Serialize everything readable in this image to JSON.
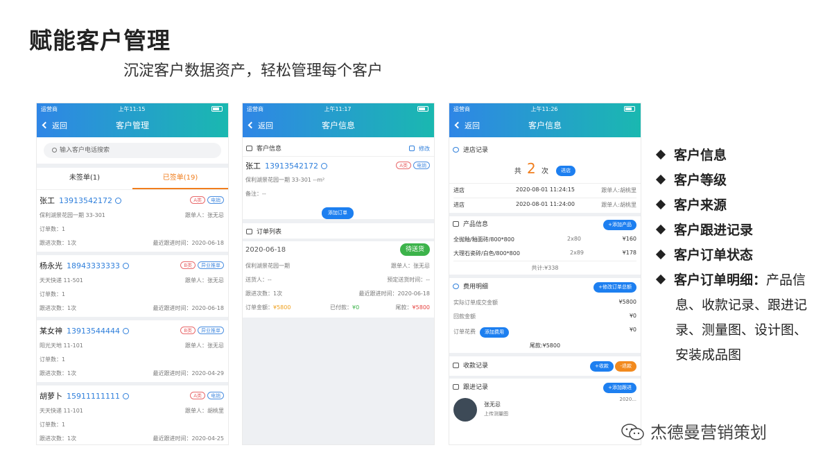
{
  "slide": {
    "title": "赋能客户管理",
    "subtitle": "沉淀客户数据资产，轻松管理每个客户"
  },
  "status_bar": {
    "carrier": "运营商",
    "time1": "上午11:15",
    "time2": "上午11:17",
    "time3": "上午11:26"
  },
  "nav": {
    "back": "返回"
  },
  "screen1": {
    "title": "客户管理",
    "search_placeholder": "输入客户电话搜索",
    "tab_unsigned": "未签单(1)",
    "tab_signed": "已签单(19)",
    "customers": [
      {
        "name": "张工",
        "phone": "13913542172",
        "badges": [
          "A类",
          "电销"
        ],
        "address": "保利湖景花园一期   33-301",
        "follower": "跟单人：张无忌",
        "orders": "订单数：1",
        "follow_count": "跟进次数：1次",
        "last_follow": "最近跟进时间：2020-06-18"
      },
      {
        "name": "杨永光",
        "phone": "18943333333",
        "badges": [
          "B类",
          "异业推单"
        ],
        "address": "天天快递   11-501",
        "follower": "跟单人：张无忌",
        "orders": "订单数：1",
        "follow_count": "跟进次数：1次",
        "last_follow": "最近跟进时间：2020-06-18"
      },
      {
        "name": "某女神",
        "phone": "13913544444",
        "badges": [
          "B类",
          "异业推单"
        ],
        "address": "阳光天地   11-101",
        "follower": "跟单人：张无忌",
        "orders": "订单数：1",
        "follow_count": "跟进次数：1次",
        "last_follow": "最近跟进时间：2020-04-29"
      },
      {
        "name": "胡萝卜",
        "phone": "15911111111",
        "badges": [
          "A类",
          "电销"
        ],
        "address": "天天快递   11-101",
        "follower": "跟单人：胡桃里",
        "orders": "订单数：1",
        "follow_count": "跟进次数：1次",
        "last_follow": "最近跟进时间：2020-04-25"
      }
    ]
  },
  "screen2": {
    "title": "客户信息",
    "info_header": "客户信息",
    "edit": "修改",
    "name": "张工",
    "phone": "13913542172",
    "badges": [
      "A类",
      "电销"
    ],
    "address": "保利湖景花园一期   33-301      --m²",
    "remark": "备注：--",
    "add_order": "添加订单",
    "orders_header": "订单列表",
    "order": {
      "date": "2020-06-18",
      "status": "待送货",
      "address": "保利湖景花园一期",
      "follower": "跟单人：张无忌",
      "deliverer": "送货人：--",
      "expected": "预定送货时间：--",
      "follow_count": "跟进次数：1次",
      "last_follow": "最近跟进时间：2020-06-18",
      "amount_label": "订单金额：",
      "amount": "¥5800",
      "paid_label": "已付款：",
      "paid": "¥0",
      "tail_label": "尾款：",
      "tail": "¥5800"
    }
  },
  "screen3": {
    "title": "客户信息",
    "visits_header": "进店记录",
    "visit_total_pre": "共",
    "visit_total": "2",
    "visit_total_post": "次",
    "visit_button": "进店",
    "visits": [
      {
        "type": "进店",
        "time": "2020-08-01 11:24:15",
        "follower": "跟单人:胡桃里"
      },
      {
        "type": "进店",
        "time": "2020-08-01 11:24:00",
        "follower": "跟单人:胡桃里"
      }
    ],
    "products_header": "产品信息",
    "add_product": "+添加产品",
    "products": [
      {
        "name": "全抛釉/釉面砖/800*800",
        "qty": "2x80",
        "price": "¥160"
      },
      {
        "name": "大理石瓷砖/白色/800*800",
        "qty": "2x89",
        "price": "¥178"
      }
    ],
    "products_total": "共计:¥338",
    "fees_header": "费用明细",
    "edit_order_total": "+修改订单总额",
    "fee_rows": [
      {
        "label": "实际订单成交金额",
        "value": "¥5800"
      },
      {
        "label": "回款金额",
        "value": "¥0"
      },
      {
        "label": "订单花费",
        "value": "¥0"
      }
    ],
    "add_fee": "添加费用",
    "fees_tail": "尾款:¥5800",
    "payments_header": "收款记录",
    "receive": "+收款",
    "refund": "-退款",
    "follow_header": "跟进记录",
    "add_follow": "+添加跟进",
    "follow_person": "张无忌",
    "follow_desc": "上传测量图",
    "follow_date": "2020..."
  },
  "features": {
    "items": [
      "客户信息",
      "客户等级",
      "客户来源",
      "客户跟进记录",
      "客户订单状态"
    ],
    "last_bold": "客户订单明细：",
    "last_normal_1": "产品信",
    "last_lines": [
      "息、收款记录、跟进记",
      "录、测量图、设计图、",
      "安装成品图"
    ]
  },
  "watermark": "杰德曼营销策划",
  "colors": {
    "accent_blue": "#1d7ff0",
    "accent_orange": "#f07d1c",
    "accent_red": "#e64340",
    "accent_green": "#3cb34a"
  }
}
